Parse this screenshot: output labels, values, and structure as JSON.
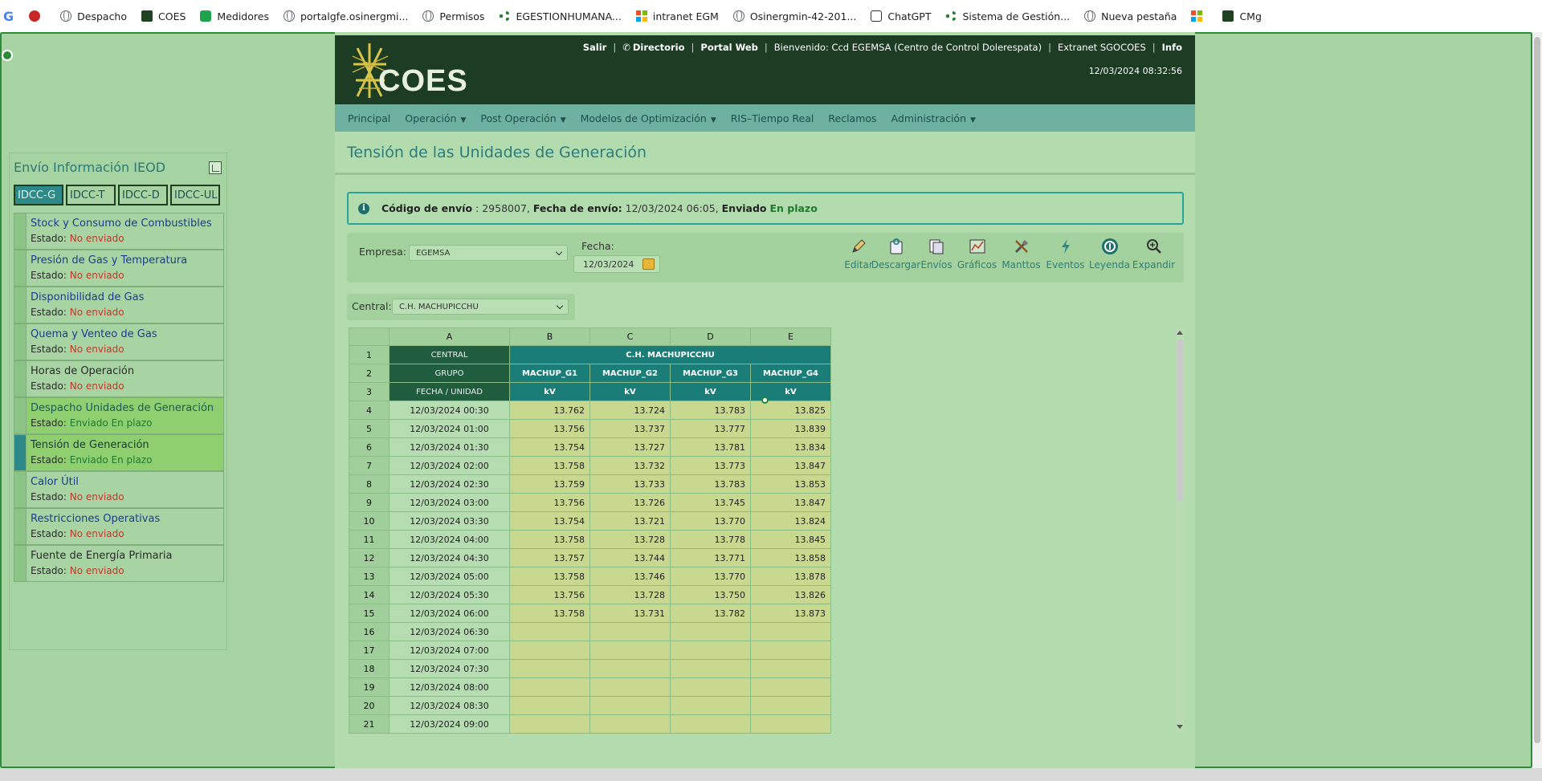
{
  "browser": {
    "bookmarks": [
      {
        "label": "Despacho",
        "icon": "globe-icon"
      },
      {
        "label": "COES",
        "icon": "coes-icon"
      },
      {
        "label": "Medidores",
        "icon": "medidores-icon"
      },
      {
        "label": "portalgfe.osinergmi...",
        "icon": "globe-icon"
      },
      {
        "label": "Permisos",
        "icon": "globe-icon"
      },
      {
        "label": "EGESTIONHUMANA...",
        "icon": "egestion-icon"
      },
      {
        "label": "intranet EGM",
        "icon": "microsoft-icon"
      },
      {
        "label": "Osinergmin-42-201...",
        "icon": "globe-icon"
      },
      {
        "label": "ChatGPT",
        "icon": "chatgpt-icon"
      },
      {
        "label": "Sistema de Gestión...",
        "icon": "share-icon"
      },
      {
        "label": "Nueva pestaña",
        "icon": "globe-icon"
      },
      {
        "label": "",
        "icon": "microsoft-icon"
      },
      {
        "label": "CMg",
        "icon": "coes-icon"
      }
    ]
  },
  "header": {
    "logo_text": "COES",
    "links": [
      "Salir",
      "Directorio",
      "Portal Web",
      "Bienvenido: Ccd EGEMSA (Centro de Control Dolerespata)",
      "Extranet SGOCOES",
      "Info"
    ],
    "datetime": "12/03/2024 08:32:56"
  },
  "nav": {
    "items": [
      {
        "label": "Principal",
        "dropdown": false
      },
      {
        "label": "Operación",
        "dropdown": true
      },
      {
        "label": "Post Operación",
        "dropdown": true
      },
      {
        "label": "Modelos de Optimización",
        "dropdown": true
      },
      {
        "label": "RIS–Tiempo Real",
        "dropdown": false
      },
      {
        "label": "Reclamos",
        "dropdown": false
      },
      {
        "label": "Administración",
        "dropdown": true
      }
    ]
  },
  "sidebar": {
    "title": "Envío Información IEOD",
    "tabs": [
      "IDCC-G",
      "IDCC-T",
      "IDCC-D",
      "IDCC-UL"
    ],
    "active_tab": "IDCC-G",
    "status_label": "Estado:",
    "items": [
      {
        "name": "Stock y Consumo de Combustibles",
        "status": "No enviado"
      },
      {
        "name": "Presión de Gas y Temperatura",
        "status": "No enviado"
      },
      {
        "name": "Disponibilidad de Gas",
        "status": "No enviado"
      },
      {
        "name": "Quema y Venteo de Gas",
        "status": "No enviado"
      },
      {
        "name": "Horas de Operación",
        "status": "No enviado"
      },
      {
        "name": "Despacho Unidades de Generación",
        "status": "Enviado En plazo"
      },
      {
        "name": "Tensión de Generación",
        "status": "Enviado En plazo"
      },
      {
        "name": "Calor Útil",
        "status": "No enviado"
      },
      {
        "name": "Restricciones Operativas",
        "status": "No enviado"
      },
      {
        "name": "Fuente de Energía Primaria",
        "status": "No enviado"
      }
    ]
  },
  "page": {
    "title": "Tensión de las Unidades de Generación",
    "alert": {
      "code_label": "Código de envío",
      "code_value": ": 2958007,",
      "date_label": "Fecha de envío:",
      "date_value": "12/03/2024 06:05,",
      "sent_label": "Enviado",
      "sent_status": "En plazo"
    },
    "toolbar": {
      "empresa_label": "Empresa:",
      "empresa_value": "EGEMSA",
      "fecha_label": "Fecha:",
      "fecha_value": "12/03/2024",
      "central_label": "Central:",
      "central_value": "C.H. MACHUPICCHU",
      "actions": [
        "Editar",
        "Descargar",
        "Envíos",
        "Gráficos",
        "Manttos",
        "Eventos",
        "Leyenda",
        "Expandir"
      ]
    }
  },
  "grid": {
    "col_letters": [
      "A",
      "B",
      "C",
      "D",
      "E"
    ],
    "header_rows": {
      "central_label": "CENTRAL",
      "central_value": "C.H. MACHUPICCHU",
      "grupo_label": "GRUPO",
      "grupos": [
        "MACHUP_G1",
        "MACHUP_G2",
        "MACHUP_G3",
        "MACHUP_G4"
      ],
      "fecha_label": "FECHA / UNIDAD",
      "units": [
        "kV",
        "kV",
        "kV",
        "kV"
      ]
    },
    "rows": [
      {
        "n": "4",
        "fecha": "12/03/2024 00:30",
        "v": [
          "13.762",
          "13.724",
          "13.783",
          "13.825"
        ]
      },
      {
        "n": "5",
        "fecha": "12/03/2024 01:00",
        "v": [
          "13.756",
          "13.737",
          "13.777",
          "13.839"
        ]
      },
      {
        "n": "6",
        "fecha": "12/03/2024 01:30",
        "v": [
          "13.754",
          "13.727",
          "13.781",
          "13.834"
        ]
      },
      {
        "n": "7",
        "fecha": "12/03/2024 02:00",
        "v": [
          "13.758",
          "13.732",
          "13.773",
          "13.847"
        ]
      },
      {
        "n": "8",
        "fecha": "12/03/2024 02:30",
        "v": [
          "13.759",
          "13.733",
          "13.783",
          "13.853"
        ]
      },
      {
        "n": "9",
        "fecha": "12/03/2024 03:00",
        "v": [
          "13.756",
          "13.726",
          "13.745",
          "13.847"
        ]
      },
      {
        "n": "10",
        "fecha": "12/03/2024 03:30",
        "v": [
          "13.754",
          "13.721",
          "13.770",
          "13.824"
        ]
      },
      {
        "n": "11",
        "fecha": "12/03/2024 04:00",
        "v": [
          "13.758",
          "13.728",
          "13.778",
          "13.845"
        ]
      },
      {
        "n": "12",
        "fecha": "12/03/2024 04:30",
        "v": [
          "13.757",
          "13.744",
          "13.771",
          "13.858"
        ]
      },
      {
        "n": "13",
        "fecha": "12/03/2024 05:00",
        "v": [
          "13.758",
          "13.746",
          "13.770",
          "13.878"
        ]
      },
      {
        "n": "14",
        "fecha": "12/03/2024 05:30",
        "v": [
          "13.756",
          "13.728",
          "13.750",
          "13.826"
        ]
      },
      {
        "n": "15",
        "fecha": "12/03/2024 06:00",
        "v": [
          "13.758",
          "13.731",
          "13.782",
          "13.873"
        ]
      },
      {
        "n": "16",
        "fecha": "12/03/2024 06:30",
        "v": [
          "",
          "",
          "",
          ""
        ]
      },
      {
        "n": "17",
        "fecha": "12/03/2024 07:00",
        "v": [
          "",
          "",
          "",
          ""
        ]
      },
      {
        "n": "18",
        "fecha": "12/03/2024 07:30",
        "v": [
          "",
          "",
          "",
          ""
        ]
      },
      {
        "n": "19",
        "fecha": "12/03/2024 08:00",
        "v": [
          "",
          "",
          "",
          ""
        ]
      },
      {
        "n": "20",
        "fecha": "12/03/2024 08:30",
        "v": [
          "",
          "",
          "",
          ""
        ]
      },
      {
        "n": "21",
        "fecha": "12/03/2024 09:00",
        "v": [
          "",
          "",
          "",
          ""
        ]
      }
    ]
  },
  "colors": {
    "header_bg": "#1c3d23",
    "nav_bg": "#6eb1a0",
    "accent_teal": "#1a7d77",
    "status_red": "#c0392b",
    "status_green": "#1e7a2c"
  }
}
